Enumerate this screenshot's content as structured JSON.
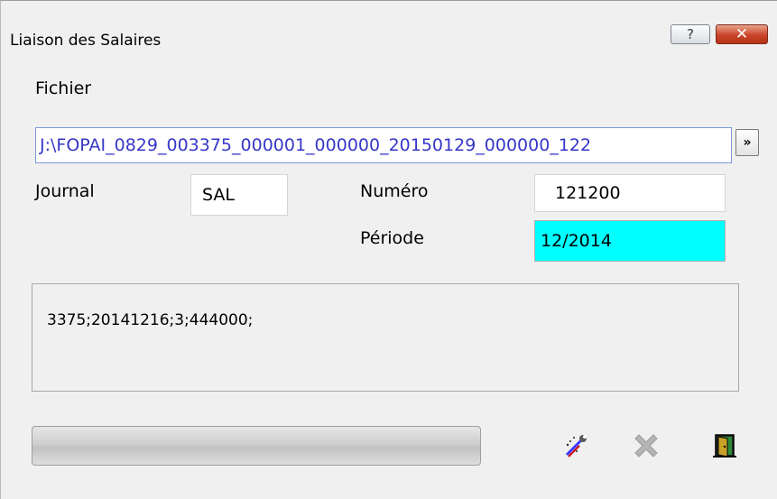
{
  "window": {
    "title": "Liaison des Salaires",
    "help_label": "?",
    "close_label": "✕"
  },
  "fichier": {
    "label": "Fichier",
    "value": "J:\\FOPAI_0829_003375_000001_000000_20150129_000000_122",
    "browse_label": "»"
  },
  "journal": {
    "label": "Journal",
    "value": "SAL"
  },
  "numero": {
    "label": "Numéro",
    "value": "121200"
  },
  "periode": {
    "label": "Période",
    "value": "12/2014",
    "highlight_color": "#00ffff"
  },
  "memo": {
    "text": "3375;20141216;3;444000;"
  },
  "progress": {
    "fraction": 0.0
  },
  "actions": [
    {
      "icon": "run-wizard-icon",
      "enabled": true
    },
    {
      "icon": "delete-x-icon",
      "enabled": false
    },
    {
      "icon": "exit-door-icon",
      "enabled": true
    }
  ]
}
